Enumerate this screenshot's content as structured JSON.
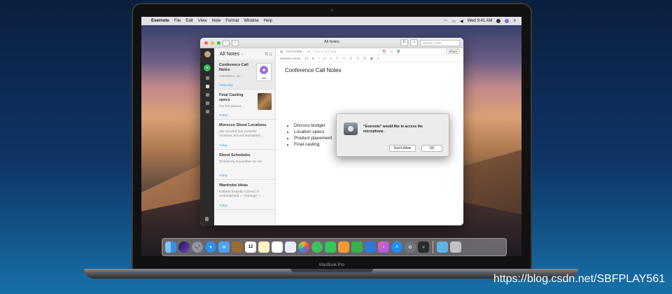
{
  "menubar": {
    "app": "Evernote",
    "items": [
      "File",
      "Edit",
      "View",
      "Note",
      "Format",
      "Window",
      "Help"
    ],
    "clock": "Wed 9:41 AM"
  },
  "window": {
    "title": "All Notes",
    "search_placeholder": "Search notes"
  },
  "notelist": {
    "header": "All Notes",
    "notes": [
      {
        "title": "Conference Call Notes",
        "snippet": "Attendees: Ja...",
        "date": "Yesterday",
        "thumb_label": "Wila"
      },
      {
        "title": "Final Casting specs",
        "snippet": "For the dancer...",
        "date": "Today"
      },
      {
        "title": "Morocco Shoot Locations",
        "snippet": "We scouted four possible locations around Marrakesh...",
        "date": "Today"
      },
      {
        "title": "Shoot Schedules",
        "snippet": "Tentatively November 12–16",
        "date": "Today"
      },
      {
        "title": "Wardrobe Ideas",
        "snippet": "Kaftans (brightly colored or embroidered) — Sarongs —...",
        "date": "Today"
      }
    ]
  },
  "editor": {
    "notebook": "First Noteb...",
    "tag_hint": "Click to add tags",
    "font": "Helvetica Neue",
    "font_size": "14",
    "share_label": "Share",
    "title": "Conference Call Notes",
    "bullets": [
      "Discuss budget",
      "Location specs",
      "Product placement",
      "Final casting"
    ]
  },
  "dialog": {
    "message": "“Evernote” would like to access the microphone.",
    "deny_label": "Don't Allow",
    "ok_label": "OK"
  },
  "dock": {
    "apps": [
      "finder-icon",
      "siri-icon",
      "launchpad-icon",
      "safari-icon",
      "mail-icon",
      "notes-app-icon",
      "calendar-icon",
      "stickies-icon",
      "reminders-icon",
      "photos-icon",
      "photos-color-icon",
      "messages-icon",
      "facetime-icon",
      "pages-icon",
      "numbers-icon",
      "keynote-icon",
      "music-icon",
      "appstore-icon",
      "settings-icon",
      "evernote-icon",
      "folder-icon",
      "trash-icon"
    ],
    "calendar_day": "12"
  },
  "device": {
    "label": "MacBook Pro"
  },
  "watermark": "https://blog.csdn.net/SBFPLAY561"
}
